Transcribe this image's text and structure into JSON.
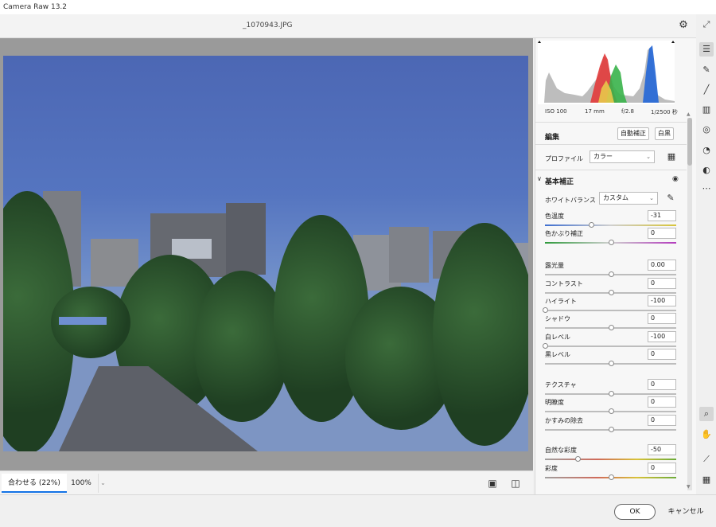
{
  "window": {
    "title": "Camera Raw 13.2"
  },
  "topbar": {
    "filename": "_1070943.JPG",
    "settings_icon": "gear-icon",
    "expand_icon": "expand-icon"
  },
  "bottom": {
    "zoom_fit": "合わせる (22%)",
    "zoom_100": "100%"
  },
  "footer": {
    "ok": "OK",
    "cancel": "キャンセル"
  },
  "meta": {
    "iso": "ISO 100",
    "focal": "17 mm",
    "aperture": "f/2.8",
    "shutter": "1/2500 秒"
  },
  "edit": {
    "title": "編集",
    "auto": "自動補正",
    "bw": "白黒"
  },
  "profile": {
    "label": "プロファイル",
    "value": "カラー"
  },
  "basic": {
    "title": "基本補正"
  },
  "wb": {
    "label": "ホワイトバランス",
    "value": "カスタム"
  },
  "sliders": [
    {
      "label": "色温度",
      "value": "-31",
      "norm": 0.35,
      "track": "temp"
    },
    {
      "label": "色かぶり補正",
      "value": "0",
      "norm": 0.5,
      "track": "tint"
    },
    {
      "label": "露光量",
      "value": "0.00",
      "norm": 0.5,
      "track": ""
    },
    {
      "label": "コントラスト",
      "value": "0",
      "norm": 0.5,
      "track": ""
    },
    {
      "label": "ハイライト",
      "value": "-100",
      "norm": 0.0,
      "track": ""
    },
    {
      "label": "シャドウ",
      "value": "0",
      "norm": 0.5,
      "track": ""
    },
    {
      "label": "白レベル",
      "value": "-100",
      "norm": 0.0,
      "track": ""
    },
    {
      "label": "黒レベル",
      "value": "0",
      "norm": 0.5,
      "track": ""
    },
    {
      "label": "テクスチャ",
      "value": "0",
      "norm": 0.5,
      "track": ""
    },
    {
      "label": "明瞭度",
      "value": "0",
      "norm": 0.5,
      "track": ""
    },
    {
      "label": "かすみの除去",
      "value": "0",
      "norm": 0.5,
      "track": ""
    },
    {
      "label": "自然な彩度",
      "value": "-50",
      "norm": 0.25,
      "track": "vib"
    },
    {
      "label": "彩度",
      "value": "0",
      "norm": 0.5,
      "track": "sat"
    }
  ],
  "colors": {
    "accent": "#1473e6"
  }
}
